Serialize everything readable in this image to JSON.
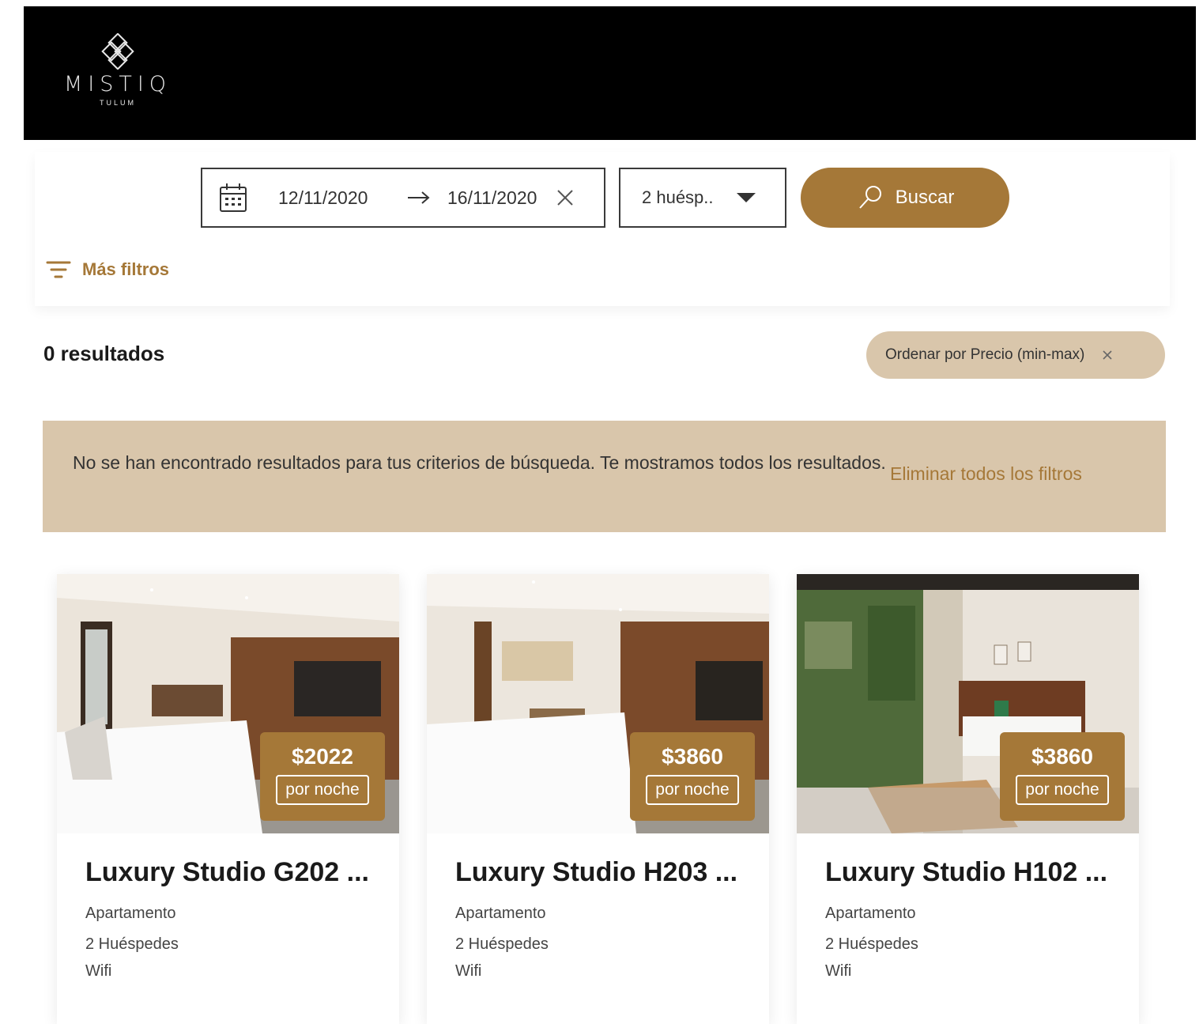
{
  "brand": {
    "name": "MISTIQ",
    "sub": "TULUM"
  },
  "search": {
    "check_in": "12/11/2020",
    "check_out": "16/11/2020",
    "guests": "2 huésp..",
    "button": "Buscar",
    "more_filters": "Más filtros"
  },
  "results": {
    "count_label": "0 resultados",
    "sort_label": "Ordenar por Precio (min-max)"
  },
  "notice": {
    "message": "No se han encontrado resultados para tus criterios de búsqueda. Te mostramos todos los resultados.",
    "clear_link": "Eliminar todos los filtros"
  },
  "listings": [
    {
      "title": "Luxury Studio G202 ...",
      "price": "$2022",
      "unit": "por noche",
      "type": "Apartamento",
      "guests": "2 Huéspedes",
      "amenity": "Wifi"
    },
    {
      "title": "Luxury Studio H203 ...",
      "price": "$3860",
      "unit": "por noche",
      "type": "Apartamento",
      "guests": "2 Huéspedes",
      "amenity": "Wifi"
    },
    {
      "title": "Luxury Studio H102 ...",
      "price": "$3860",
      "unit": "por noche",
      "type": "Apartamento",
      "guests": "2 Huéspedes",
      "amenity": "Wifi"
    }
  ],
  "colors": {
    "accent": "#a57838",
    "sand": "#d9c6ab",
    "header": "#000000"
  }
}
